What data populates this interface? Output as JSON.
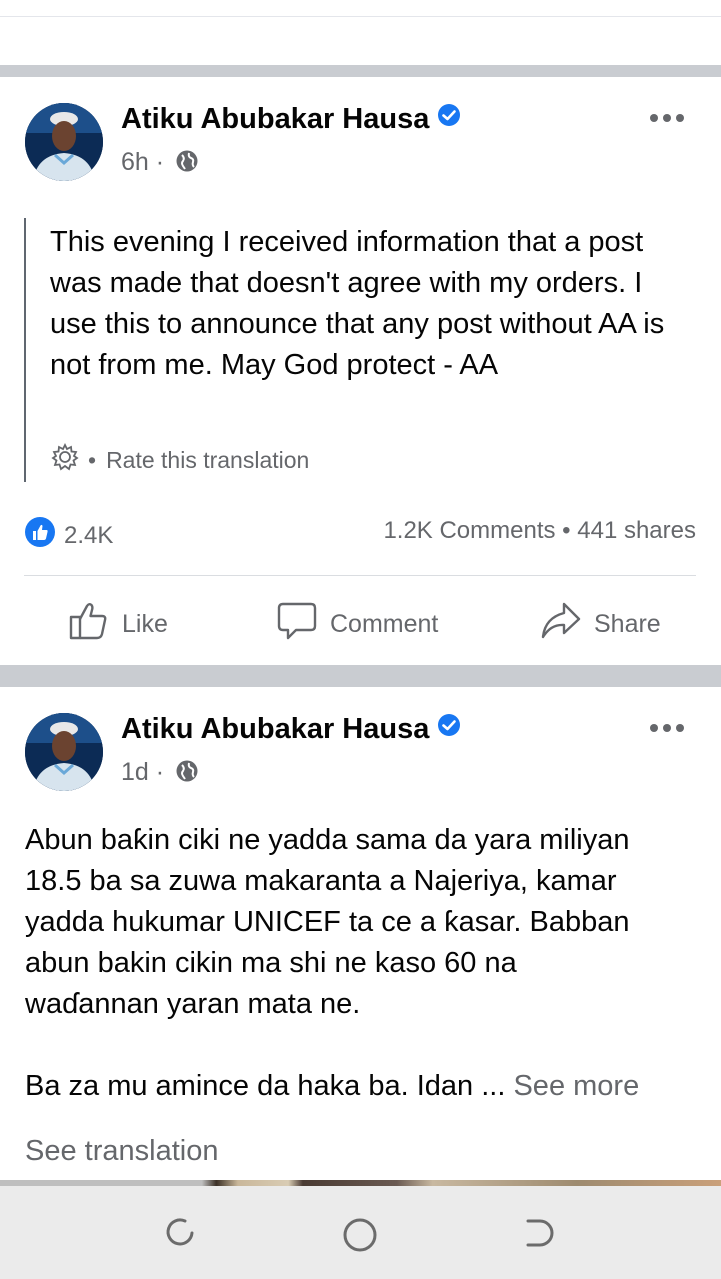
{
  "posts": [
    {
      "author": "Atiku Abubakar Hausa",
      "time": "6h",
      "meta_sep": "·",
      "text": "This evening I received information that a post was made that doesn't agree with my orders. I use this to announce that any post without AA is not from me. May God protect - AA",
      "rate_translation": "Rate this translation",
      "rate_sep": "•",
      "reactions": "2.4K",
      "comments_shares": "1.2K Comments • 441 shares",
      "actions": {
        "like": "Like",
        "comment": "Comment",
        "share": "Share"
      }
    },
    {
      "author": "Atiku Abubakar Hausa",
      "time": "1d",
      "meta_sep": "·",
      "text_lines": [
        "Abun baƙin ciki ne yadda sama da yara miliyan",
        "18.5 ba sa zuwa makaranta a Najeriya, kamar",
        "yadda hukumar UNICEF ta ce a ƙasar. Babban",
        "abun bakin cikin ma shi ne kaso 60 na",
        "waɗannan yaran mata ne."
      ],
      "text_last": "Ba za mu amince da haka ba. Idan ...",
      "see_more": "See more",
      "see_translation": "See translation"
    }
  ],
  "icons": {
    "verified": "verified-badge-icon",
    "audience": "globe-icon",
    "more": "more-options-icon",
    "settings": "gear-icon",
    "like_reaction": "thumbs-up-reaction-icon",
    "like": "thumbs-up-icon",
    "comment": "speech-bubble-icon",
    "share": "share-arrow-icon",
    "recents": "recent-apps-icon",
    "home": "home-circle-icon",
    "back": "back-icon"
  },
  "colors": {
    "verified_blue": "#1877f2",
    "secondary_text": "#65676b",
    "separator": "#c9ccd1",
    "navbar": "#ebebeb"
  }
}
